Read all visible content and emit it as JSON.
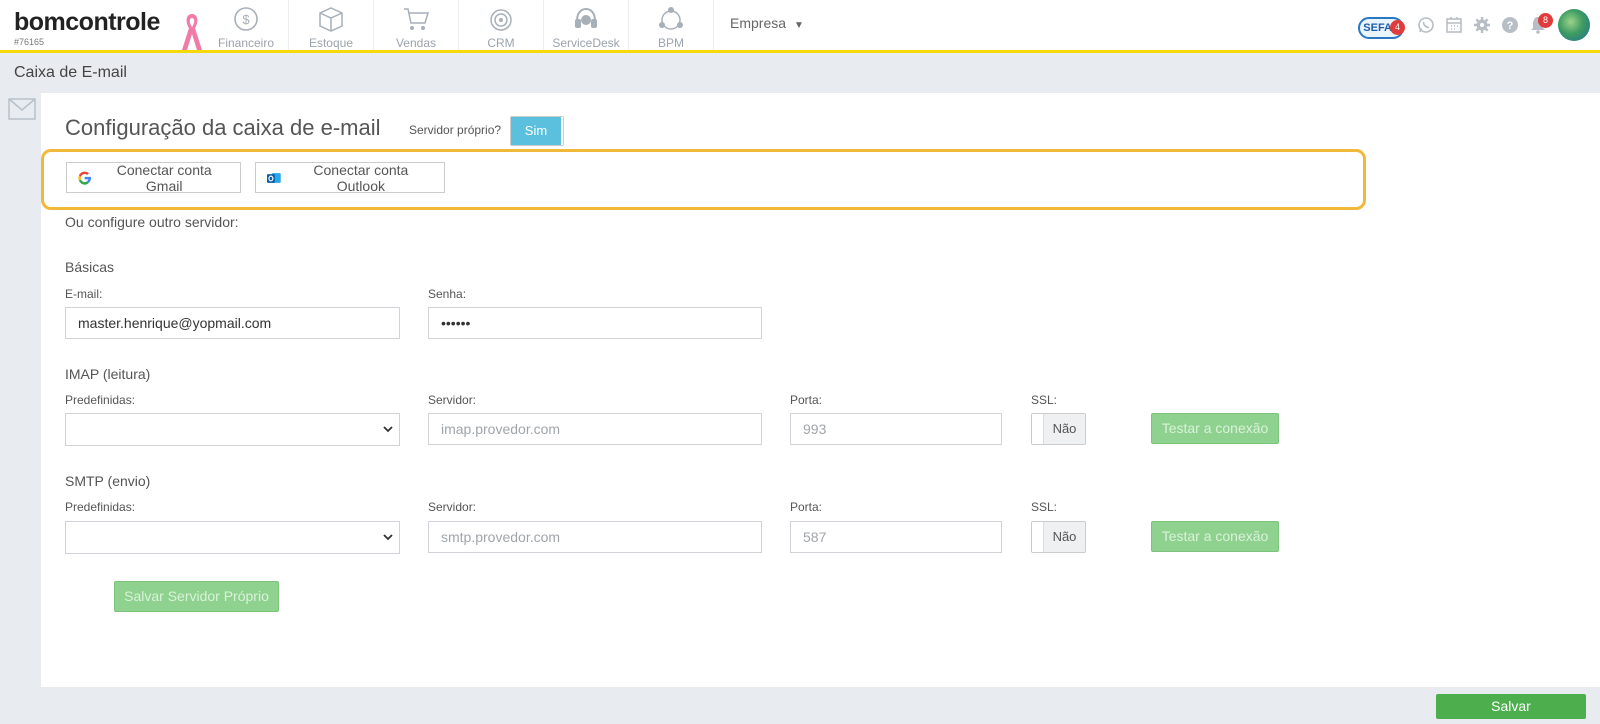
{
  "brand": {
    "name": "bomcontrole",
    "account_id": "#76165"
  },
  "nav": {
    "modules": [
      {
        "label": "Financeiro",
        "icon": "financeiro-icon"
      },
      {
        "label": "Estoque",
        "icon": "estoque-icon"
      },
      {
        "label": "Vendas",
        "icon": "vendas-icon"
      },
      {
        "label": "CRM",
        "icon": "crm-icon"
      },
      {
        "label": "ServiceDesk",
        "icon": "servicedesk-icon"
      },
      {
        "label": "BPM",
        "icon": "bpm-icon"
      }
    ],
    "company_label": "Empresa",
    "sefaz_label": "SEFAZ",
    "sefaz_badge": "4",
    "notifications_badge": "8"
  },
  "page": {
    "title": "Caixa de E-mail"
  },
  "config": {
    "heading": "Configuração da caixa de e-mail",
    "own_server_label": "Servidor próprio?",
    "own_server_value": "Sim",
    "gmail_button": "Conectar conta Gmail",
    "outlook_button": "Conectar conta Outlook",
    "or_text": "Ou configure outro servidor:"
  },
  "basic": {
    "section": "Básicas",
    "email_label": "E-mail:",
    "email_value": "master.henrique@yopmail.com",
    "password_label": "Senha:",
    "password_value": "••••••"
  },
  "imap": {
    "section": "IMAP (leitura)",
    "preset_label": "Predefinidas:",
    "server_label": "Servidor:",
    "server_placeholder": "imap.provedor.com",
    "port_label": "Porta:",
    "port_placeholder": "993",
    "ssl_label": "SSL:",
    "ssl_value": "Não",
    "test_button": "Testar a conexão"
  },
  "smtp": {
    "section": "SMTP (envio)",
    "preset_label": "Predefinidas:",
    "server_label": "Servidor:",
    "server_placeholder": "smtp.provedor.com",
    "port_label": "Porta:",
    "port_placeholder": "587",
    "ssl_label": "SSL:",
    "ssl_value": "Não",
    "test_button": "Testar a conexão"
  },
  "actions": {
    "save_own_server": "Salvar Servidor Próprio",
    "save": "Salvar"
  },
  "colors": {
    "accent_yellow": "#f5d90a",
    "highlight_orange": "#f0b93a",
    "toggle_blue": "#5bc0de",
    "save_green": "#4cae4c",
    "disabled_green": "#8fd18f"
  }
}
